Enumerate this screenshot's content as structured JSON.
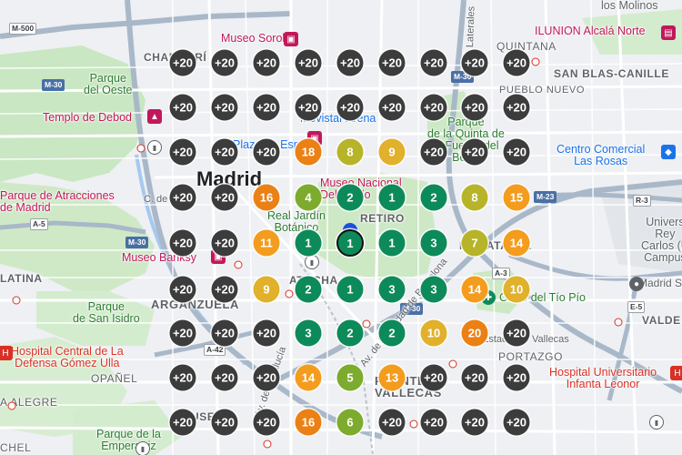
{
  "labels": {
    "chamberi": "CHAMBERÍ",
    "museo_sorolla": "Museo Sorolla",
    "parque_oeste": "Parque\ndel Oeste",
    "templo_debod": "Templo de Debod",
    "madrid": "Madrid",
    "atracciones": "Parque de Atracciones\nde Madrid",
    "c_de_mo": "C. de Mo",
    "museo_nacional": "Museo Nacional\nDel Prado",
    "retiro": "RETIRO",
    "jardin_botanico": "Real Jardín\nBotánico",
    "museo_banksy": "Museo Banksy",
    "atocha": "ATOCHA",
    "arganzuela": "ARGANZUELA",
    "parque_san_isidro": "Parque\nde San Isidro",
    "latina": "LATINA",
    "hospital_central": "Hospital Central de La\nDefensa Gómez Ulla",
    "opanel": "OPAÑEL",
    "alegre": "A ALEGRE",
    "chel": "CHEL",
    "parque_emperatriz": "Parque de la\nEmperatriz",
    "usera": "USERA",
    "puente_vallecas": "PUENTE DE\nVALLECAS",
    "portazgo": "PORTAZGO",
    "hospital_leonor": "Hospital Universitario\nInfanta Leonor",
    "cerro_tio_pio": "Cerro del Tío Pío",
    "estadio_vallecas": "Estadio de Vallecas",
    "madrid_sport": "Madrid Sp",
    "valdebernardo": "VALDE",
    "los_molinos": "los Molinos",
    "ilunion": "ILUNION Alcalá Norte",
    "quintana": "QUINTANA",
    "san_blas": "SAN BLAS-CANILLE",
    "pueblo_nuevo": "PUEBLO NUEVO",
    "centro_comercial": "Centro Comercial\nLas Rosas",
    "universidad": "Univers\nRey\nCarlos (U\nCampus",
    "movistar": "Movistar Arena",
    "quinta_fuente": "Parque\nde la Quinta de\nla Fuente del\nBerro",
    "plaza_espana": "Plaza de España",
    "moratalaz": "MORATALAZ",
    "av_ciudad": "Av. de la Ciudad de Barcelona",
    "calle_laterales": "Calle Laterales",
    "av_andalucia": "Av. de Andalucía"
  },
  "shields": {
    "m500": "M-500",
    "m30_a": "M-30",
    "m30_b": "M-30",
    "m30_c": "M-30",
    "m30_d": "M-30",
    "a5": "A-5",
    "a42": "A-42",
    "a3": "A-3",
    "m23": "M-23",
    "r3": "R-3",
    "e5": "E-5"
  },
  "colors": {
    "green": "#0d8a5a",
    "olive": "#7cab2e",
    "yellow_green": "#b7b42a",
    "yellow": "#e1b12c",
    "orange": "#f49c1e",
    "dark_orange": "#eb8015",
    "dark": "#3c3c3c"
  },
  "grid": {
    "cols": [
      201,
      247,
      293,
      339,
      385,
      431,
      477,
      522,
      568
    ],
    "rows": [
      69,
      118,
      167,
      217,
      267,
      318,
      366,
      415,
      464
    ],
    "markers": [
      [
        "+20",
        "+20",
        "+20",
        "+20",
        "+20",
        "+20",
        "+20",
        "+20",
        "+20"
      ],
      [
        "+20",
        "+20",
        "+20",
        "+20",
        "+20",
        "+20",
        "+20",
        "+20",
        "+20"
      ],
      [
        "+20",
        "+20",
        "+20",
        "18",
        "8",
        "9",
        "+20",
        "+20",
        "+20"
      ],
      [
        "+20",
        "+20",
        "16",
        "4",
        "2",
        "1",
        "2",
        "8",
        "15"
      ],
      [
        "+20",
        "+20",
        "11",
        "1",
        "1",
        "1",
        "3",
        "7",
        "14"
      ],
      [
        "+20",
        "+20",
        "9",
        "2",
        "1",
        "3",
        "3",
        "14",
        "10"
      ],
      [
        "+20",
        "+20",
        "+20",
        "3",
        "2",
        "2",
        "10",
        "20",
        "+20"
      ],
      [
        "+20",
        "+20",
        "+20",
        "14",
        "5",
        "13",
        "+20",
        "+20",
        "+20"
      ],
      [
        "+20",
        "+20",
        "+20",
        "16",
        "6",
        "+20",
        "+20",
        "+20",
        "+20"
      ]
    ]
  }
}
